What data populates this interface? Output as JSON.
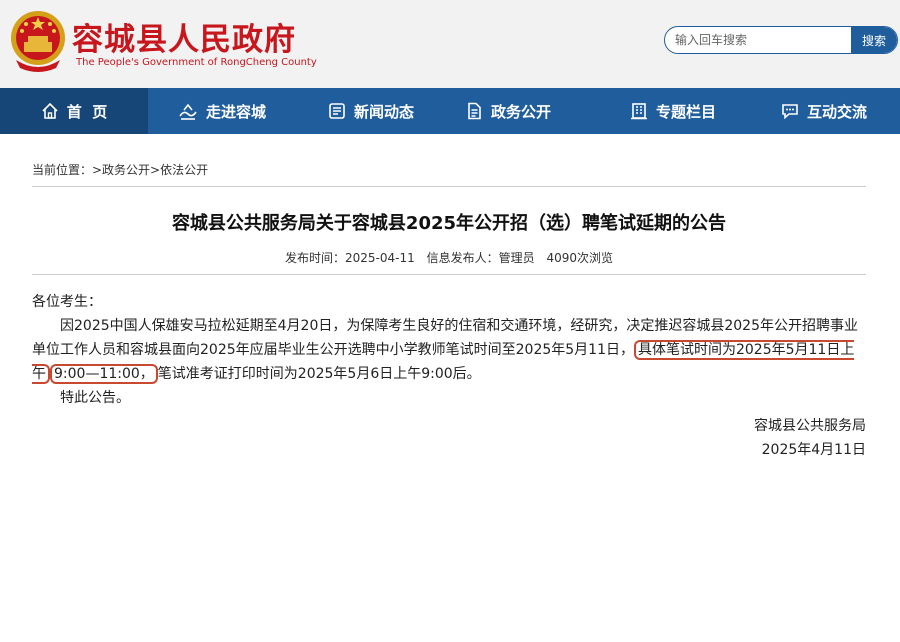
{
  "header": {
    "title": "容城县人民政府",
    "subtitle": "The People's Government of RongCheng County",
    "search": {
      "placeholder": "输入回车搜索",
      "button": "搜索"
    }
  },
  "nav": [
    {
      "label": "首  页",
      "icon": "home-icon"
    },
    {
      "label": "走进容城",
      "icon": "landscape-icon"
    },
    {
      "label": "新闻动态",
      "icon": "news-icon"
    },
    {
      "label": "政务公开",
      "icon": "document-icon"
    },
    {
      "label": "专题栏目",
      "icon": "building-icon"
    },
    {
      "label": "互动交流",
      "icon": "chat-icon"
    }
  ],
  "breadcrumb": "当前位置：>政务公开>依法公开",
  "article": {
    "title": "容城县公共服务局关于容城县2025年公开招（选）聘笔试延期的公告",
    "meta": {
      "publish": "发布时间：2025-04-11",
      "publisher": "信息发布人：管理员",
      "views": "4090次浏览"
    },
    "greeting": "各位考生：",
    "para_before": "因2025中国人保雄安马拉松延期至4月20日，为保障考生良好的住宿和交通环境，经研究，决定推迟容城县2025年公开招聘事业单位工作人员和容城县面向2025年应届毕业生公开选聘中小学教师笔试时间至2025年5月11日，",
    "para_highlight1": "具体笔试时间为2025年5月11日上午",
    "para_highlight2": "9:00—11:00，",
    "para_after": "笔试准考证打印时间为2025年5月6日上午9:00后。",
    "closing": "特此公告。",
    "signature": "容城县公共服务局",
    "date": "2025年4月11日"
  },
  "colors": {
    "brand_red": "#c8161d",
    "nav_blue": "#1f5d9c",
    "nav_active": "#164677",
    "highlight_border": "#c8492f"
  }
}
